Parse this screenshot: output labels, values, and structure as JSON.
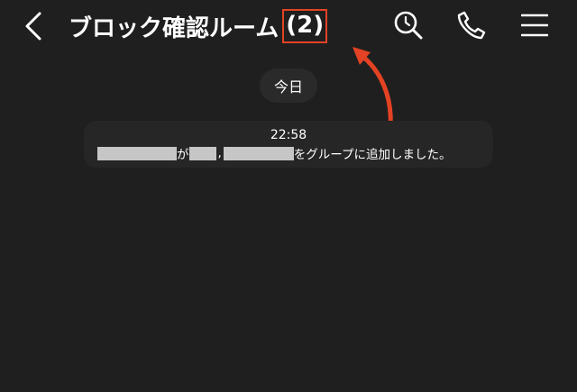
{
  "header": {
    "title": "ブロック確認ルーム",
    "member_count": "(2)",
    "icons": {
      "back": "chevron-left-icon",
      "search": "search-icon",
      "call": "phone-icon",
      "menu": "hamburger-menu-icon"
    }
  },
  "annotation": {
    "highlight_color": "#e34324"
  },
  "chat": {
    "date_label": "今日",
    "system_message": {
      "time": "22:58",
      "particle_ga": "が",
      "comma": ",",
      "suffix": "をグループに追加しました。"
    }
  }
}
